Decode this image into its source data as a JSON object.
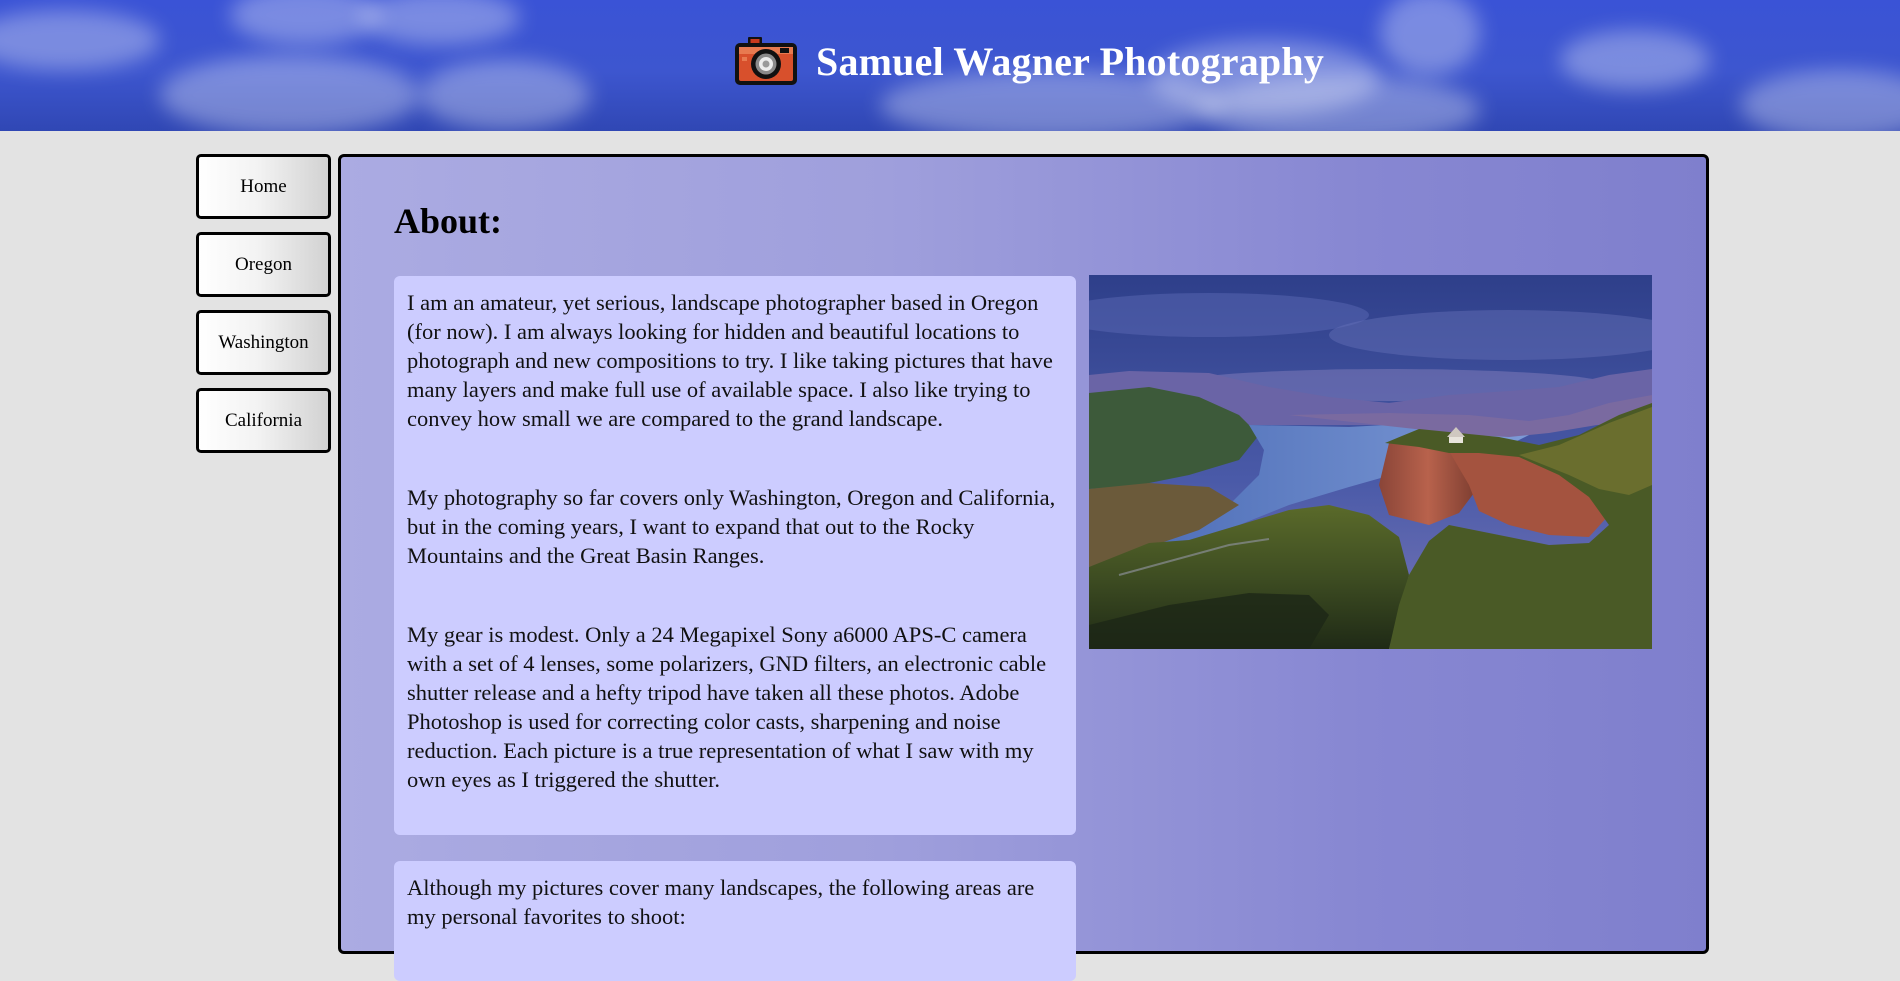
{
  "header": {
    "title": "Samuel Wagner Photography",
    "logo_icon": "camera-icon",
    "background_color": "#3a53d6"
  },
  "nav": {
    "items": [
      {
        "label": "Home"
      },
      {
        "label": "Oregon"
      },
      {
        "label": "Washington"
      },
      {
        "label": "California"
      }
    ]
  },
  "main": {
    "heading": "About:",
    "paragraphs": [
      "I am an amateur, yet serious, landscape photographer based in Oregon (for now). I am always looking for hidden and beautiful locations to photograph and new compositions to try. I like taking pictures that have many layers and make full use of available space. I also like trying to convey how small we are compared to the grand landscape.",
      "My photography so far covers only Washington, Oregon and California, but in the coming years, I want to expand that out to the Rocky Mountains and the Great Basin Ranges.",
      "My gear is modest. Only a 24 Megapixel Sony a6000 APS-C camera with a set of 4 lenses, some polarizers, GND filters, an electronic cable shutter release and a hefty tripod have taken all these photos. Adobe Photoshop is used for correcting color casts, sharpening and noise reduction. Each picture is a true representation of what I saw with my own eyes as I triggered the shutter."
    ],
    "areas_text": "Although my pictures cover many landscapes, the following areas are my personal favorites to shoot:"
  },
  "colors": {
    "page_background": "#e3e3e3",
    "text_box_background": "#ccccff",
    "panel_gradient_start": "#ababe2",
    "panel_gradient_end": "#7f7fcd"
  }
}
